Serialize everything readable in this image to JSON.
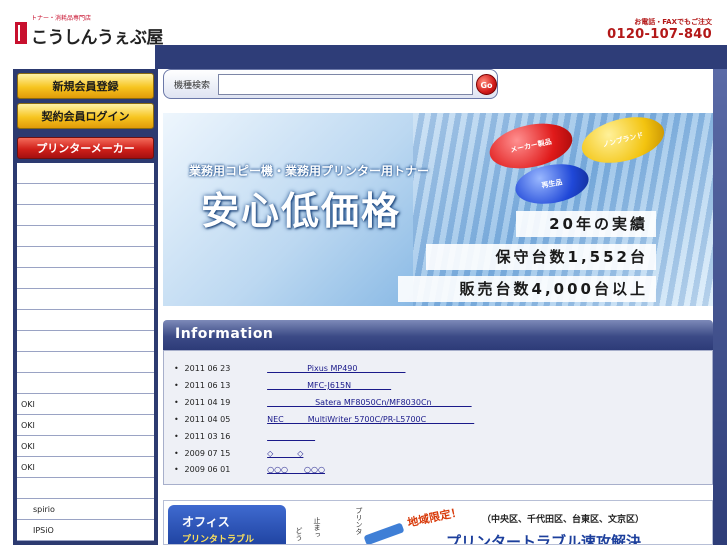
{
  "header": {
    "logo_sub": "トナー・消耗品専門店",
    "logo_text": "こうしんうぇぶ屋",
    "phone_label": "お電話・FAXでもご注文",
    "phone_number": "0120-107-840"
  },
  "search": {
    "label": "機種検索",
    "value": "",
    "go_label": "Go"
  },
  "sidebar": {
    "register_label": "新規会員登録",
    "login_label": "契約会員ログイン",
    "maker_label": "プリンターメーカー",
    "items": [
      "",
      "",
      "",
      "",
      "",
      "",
      "",
      "",
      "",
      "",
      "",
      "OKI",
      "OKI",
      "OKI",
      "OKI",
      "",
      "spirio",
      "IPSiO"
    ]
  },
  "banner": {
    "subtitle": "業務用コピー機・業務用プリンター用トナー",
    "main": "安心低価格",
    "bubble_maker": "メーカー製品",
    "bubble_nonbrand": "ノンブランド",
    "bubble_recycled": "再生品",
    "stat1": "20年の実績",
    "stat2": "保守台数1,552台",
    "stat3": "販売台数4,000台以上"
  },
  "info": {
    "title": "Information",
    "rows": [
      {
        "date": "2011 06 23",
        "text": "　　　　　Pixus MP490　　　　　　"
      },
      {
        "date": "2011 06 13",
        "text": "　　　　　MFC-J615N　　　　　"
      },
      {
        "date": "2011 04 19",
        "text": "　　　　　　Satera MF8050Cn/MF8030Cn　　　　　"
      },
      {
        "date": "2011 04 05",
        "text": "NEC　　　MultiWriter 5700C/PR-L5700C　　　　　　"
      },
      {
        "date": "2011 03 16",
        "text": "　　　　　　"
      },
      {
        "date": "2009 07 15",
        "text": "◇　　　◇"
      },
      {
        "date": "2009 06 01",
        "text": "○○○　　○○○"
      }
    ]
  },
  "bottom": {
    "office": "オフィス",
    "trouble": "プリンタトラブル",
    "vertical1": "プリンタ",
    "vertical2": "止まっ",
    "vertical3": "どう",
    "area_limited": "地域限定！",
    "districts": "（中央区、千代田区、台東区、文京区）",
    "big_text": "プリンタートラブル速攻解決"
  }
}
